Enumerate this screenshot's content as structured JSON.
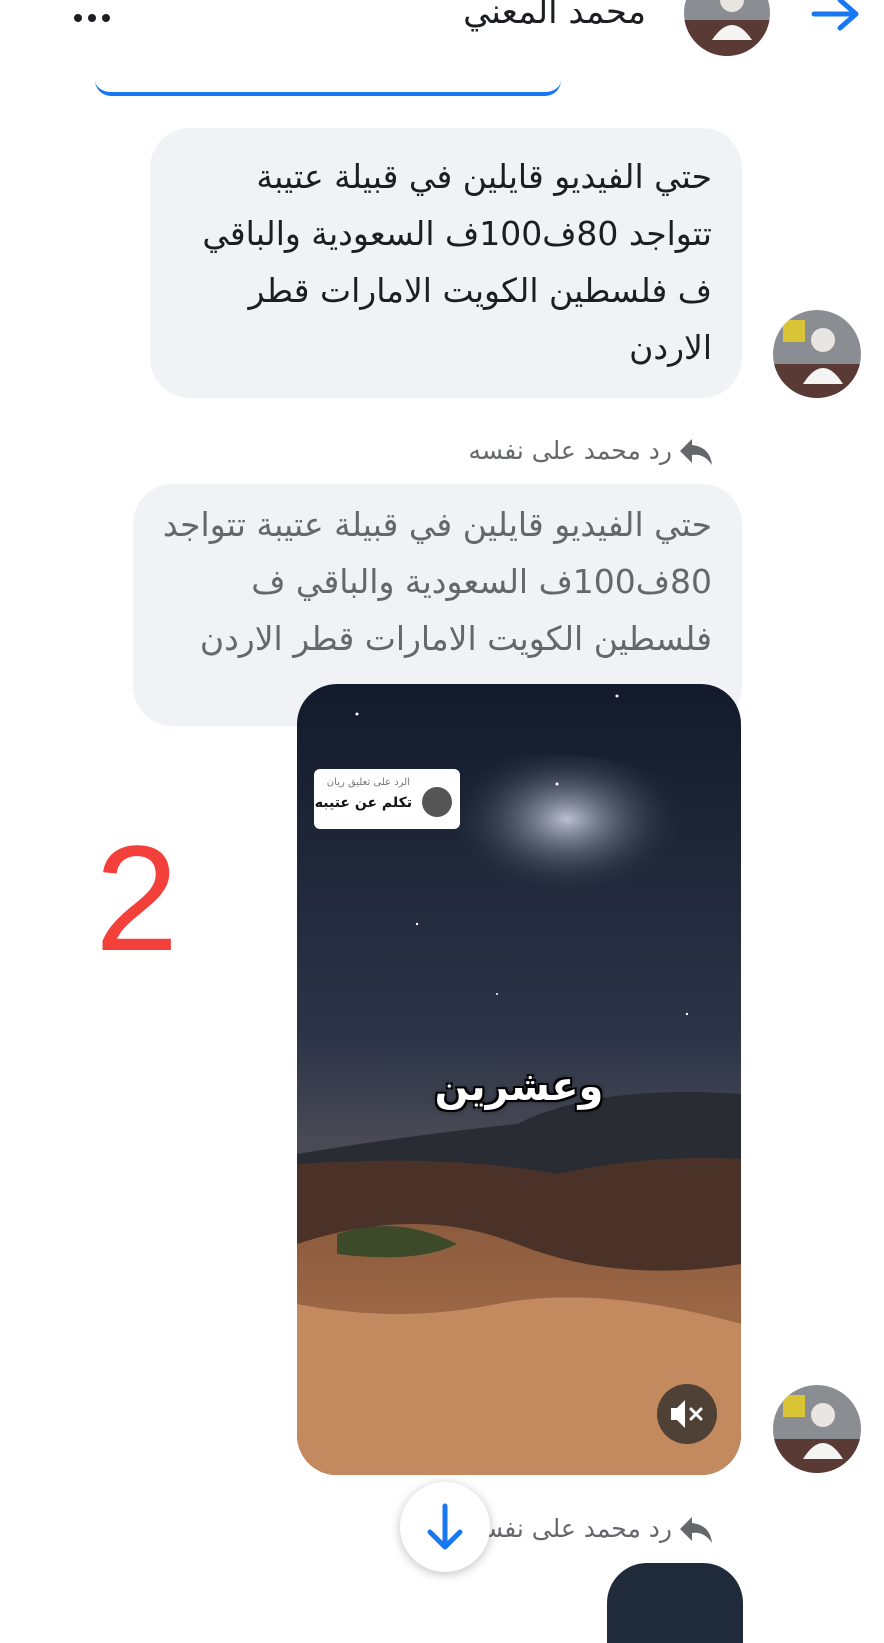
{
  "header": {
    "contact_name": "محمد المعني",
    "more_icon": "more-horizontal-icon",
    "back_icon": "arrow-right-icon"
  },
  "messages": [
    {
      "text": "حتي الفيديو قايلين في قبيلة عتيبة تتواجد 80ف100ف السعودية والباقي ف فلسطين الكويت الامارات قطر الاردن"
    },
    {
      "reply_label": "رد محمد على نفسه",
      "text": "حتي الفيديو قايلين في قبيلة عتيبة تتواجد 80ف100ف السعودية والباقي ف فلسطين الكويت الامارات قطر الاردن",
      "video": {
        "reply_tag_sub": "الرد على تعليق ريان",
        "reply_tag_main": "تكلم عن عتيبه",
        "caption": "وعشرين",
        "mute_icon": "volume-mute-icon"
      }
    },
    {
      "reply_label": "رد محمد على نفس"
    }
  ],
  "annotation": "2",
  "scroll_button_icon": "arrow-down-icon",
  "colors": {
    "accent": "#1877f2",
    "bubble": "#f0f2f5",
    "annotation": "#f4403a"
  }
}
